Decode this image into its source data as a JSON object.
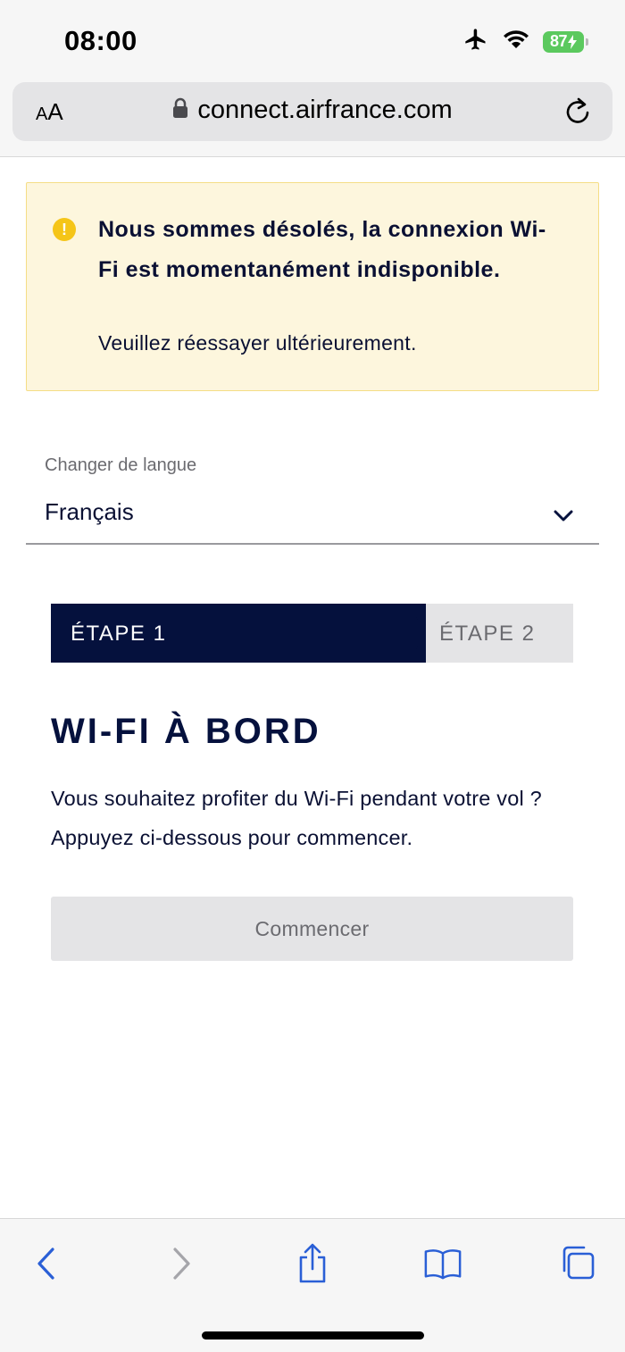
{
  "status_bar": {
    "time": "08:00",
    "battery": "87",
    "icons": [
      "airplane-icon",
      "wifi-icon",
      "battery-icon"
    ]
  },
  "browser": {
    "aa_small": "A",
    "aa_large": "A",
    "url": "connect.airfrance.com"
  },
  "alert": {
    "title": "Nous sommes désolés, la connexion Wi-Fi est momentanément indisponible.",
    "subtitle": "Veuillez réessayer ultérieurement.",
    "icon": "warning-icon",
    "color": "#f5c518"
  },
  "language": {
    "label": "Changer de langue",
    "selected": "Français"
  },
  "steps": [
    {
      "label": "ÉTAPE 1",
      "active": true
    },
    {
      "label": "ÉTAPE 2",
      "active": false
    }
  ],
  "main": {
    "title": "WI-FI À BORD",
    "description": "Vous souhaitez profiter du Wi-Fi pendant votre vol ? Appuyez ci-dessous pour commencer.",
    "start_button": "Commencer"
  },
  "toolbar": {
    "icons": [
      "back-icon",
      "forward-icon",
      "share-icon",
      "bookmarks-icon",
      "tabs-icon"
    ]
  },
  "colors": {
    "brand_navy": "#05113d",
    "ios_blue": "#2a5fd6",
    "alert_bg": "#fdf6dd",
    "battery_green": "#5bc95e"
  }
}
